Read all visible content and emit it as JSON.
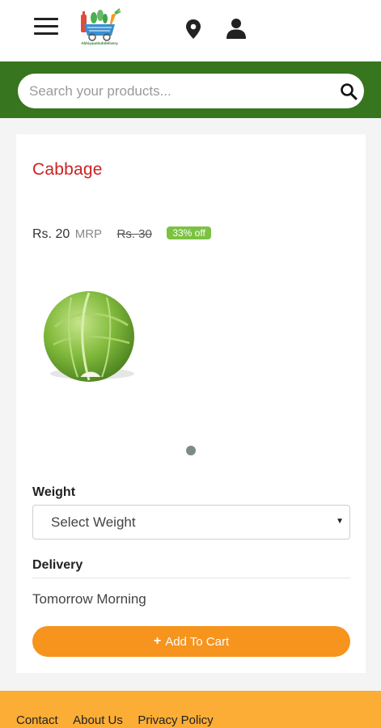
{
  "header": {
    "logo_text": "Abhiyaanhubdelivery"
  },
  "search": {
    "placeholder": "Search your products..."
  },
  "product": {
    "title": "Cabbage",
    "price": "Rs. 20",
    "mrp_label": "MRP",
    "old_price": "Rs. 30",
    "discount": "33% off"
  },
  "weight": {
    "label": "Weight",
    "selected": "Select Weight"
  },
  "delivery": {
    "label": "Delivery",
    "value": "Tomorrow Morning"
  },
  "cart": {
    "button_label": "Add To Cart"
  },
  "footer": {
    "links": [
      "Contact",
      "About Us",
      "Privacy Policy"
    ]
  },
  "colors": {
    "brand_green": "#37751f",
    "title_red": "#cc2222",
    "discount_green": "#7cc242",
    "cart_orange": "#f7941d",
    "footer_orange": "#fbad36"
  },
  "icons": {
    "menu": "hamburger-icon",
    "location": "location-pin-icon",
    "account": "user-icon",
    "search": "search-icon",
    "add": "plus-icon"
  }
}
